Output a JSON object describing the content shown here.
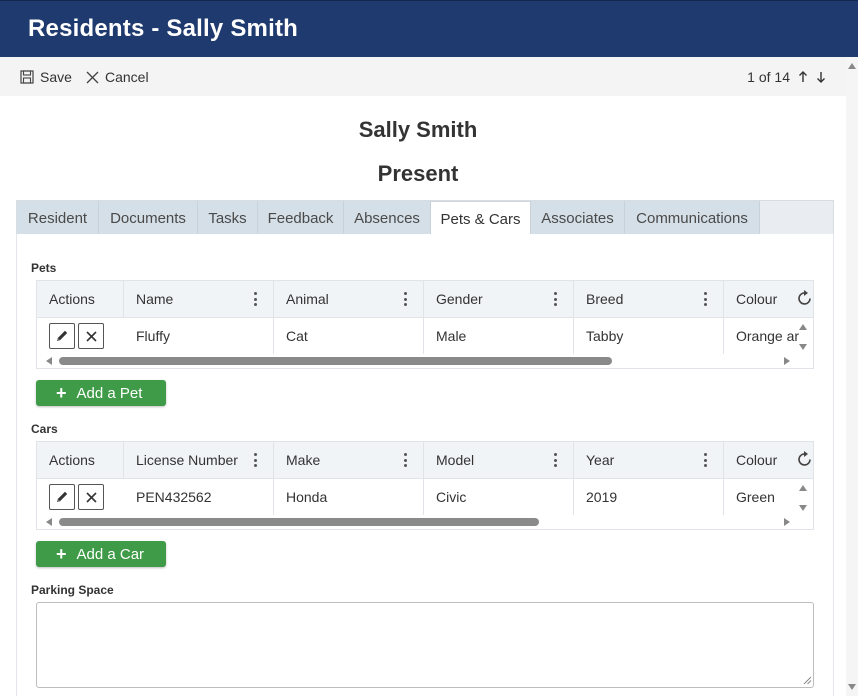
{
  "header": {
    "title": "Residents - Sally Smith"
  },
  "toolbar": {
    "save_label": "Save",
    "cancel_label": "Cancel"
  },
  "pager": {
    "text": "1 of 14"
  },
  "record": {
    "name": "Sally Smith",
    "status": "Present"
  },
  "tabs": [
    {
      "label": "Resident"
    },
    {
      "label": "Documents"
    },
    {
      "label": "Tasks"
    },
    {
      "label": "Feedback"
    },
    {
      "label": "Absences"
    },
    {
      "label": "Pets & Cars"
    },
    {
      "label": "Associates"
    },
    {
      "label": "Communications"
    }
  ],
  "pets": {
    "label": "Pets",
    "columns": [
      "Actions",
      "Name",
      "Animal",
      "Gender",
      "Breed",
      "Colour"
    ],
    "row": [
      "Fluffy",
      "Cat",
      "Male",
      "Tabby",
      "Orange ar"
    ],
    "add_label": "Add a Pet"
  },
  "cars": {
    "label": "Cars",
    "columns": [
      "Actions",
      "License Number",
      "Make",
      "Model",
      "Year",
      "Colour"
    ],
    "row": [
      "PEN432562",
      "Honda",
      "Civic",
      "2019",
      "Green"
    ],
    "add_label": "Add a Car"
  },
  "parking": {
    "label": "Parking Space",
    "value": ""
  },
  "colors": {
    "header_bg": "#1f3a6e",
    "add_button": "#3f9b47",
    "tab_bg": "#d5dfe7"
  }
}
